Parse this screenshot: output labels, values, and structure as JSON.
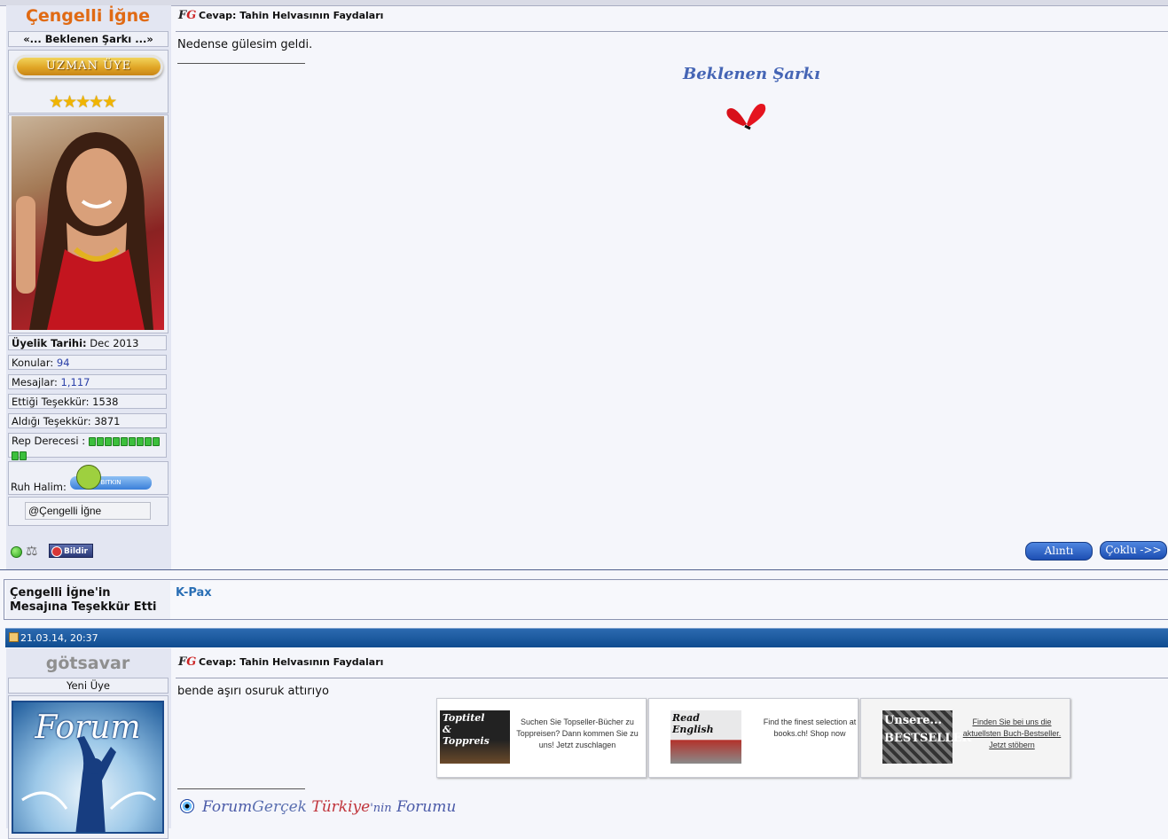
{
  "post1": {
    "author": {
      "name": "Çengelli İğne",
      "title": "«... Beklenen Şarkı ...»",
      "rank": "UZMAN ÜYE",
      "stars": "★★★★★",
      "join_label": "Üyelik Tarihi:",
      "join_value": "Dec 2013",
      "topics_label": "Konular:",
      "topics_value": "94",
      "messages_label": "Mesajlar:",
      "messages_value": "1,117",
      "gave_thanks_label": "Ettiği Teşekkür:",
      "gave_thanks_value": "1538",
      "got_thanks_label": "Aldığı Teşekkür:",
      "got_thanks_value": "3871",
      "rep_label": "Rep Derecesi :",
      "mood_label": "Ruh Halim:",
      "mood_value": "BITKIN",
      "mention": "@Çengelli İğne",
      "report_label": "Bildir"
    },
    "title": "Cevap: Tahin Helvasının Faydaları",
    "logo": "FG",
    "message": "Nedense gülesim geldi.",
    "signature": "Beklenen Şarkı",
    "quote_button": "Alıntı",
    "multi_button": "Çoklu ->>"
  },
  "thanks": {
    "label": "Çengelli İğne'in Mesajına Teşekkür Etti",
    "users": [
      "K-Pax"
    ]
  },
  "post2": {
    "date": "21.03.14, 20:37",
    "author": {
      "name": "götsavar",
      "title": "Yeni Üye",
      "avatar_text": "Forum"
    },
    "title": "Cevap: Tahin Helvasının Faydaları",
    "logo": "FG",
    "message": "bende aşırı osuruk attırıyo",
    "ads": [
      {
        "img_text": "Toptitel & Toppreis",
        "text": "Suchen Sie Topseller-Bücher zu Toppreisen? Dann kommen Sie zu uns! Jetzt zuschlagen"
      },
      {
        "img_text": "Read English",
        "text": "Find the finest selection at books.ch! Shop now"
      },
      {
        "img_text": "Unsere... BESTSELLER",
        "text": "Finden Sie bei uns die aktuellsten Buch-Bestseller. Jetzt stöbern"
      }
    ],
    "signature_parts": [
      "Forum",
      "Gerçek",
      "Türkiye",
      "'nin",
      "Forumu"
    ]
  },
  "colors": {
    "page_bg": "#f5f6fb",
    "username_orange": "#e06a14",
    "username_gray": "#8f8f8f",
    "postbar_blue": "#1558a0",
    "link_blue": "#2a6fb5"
  }
}
